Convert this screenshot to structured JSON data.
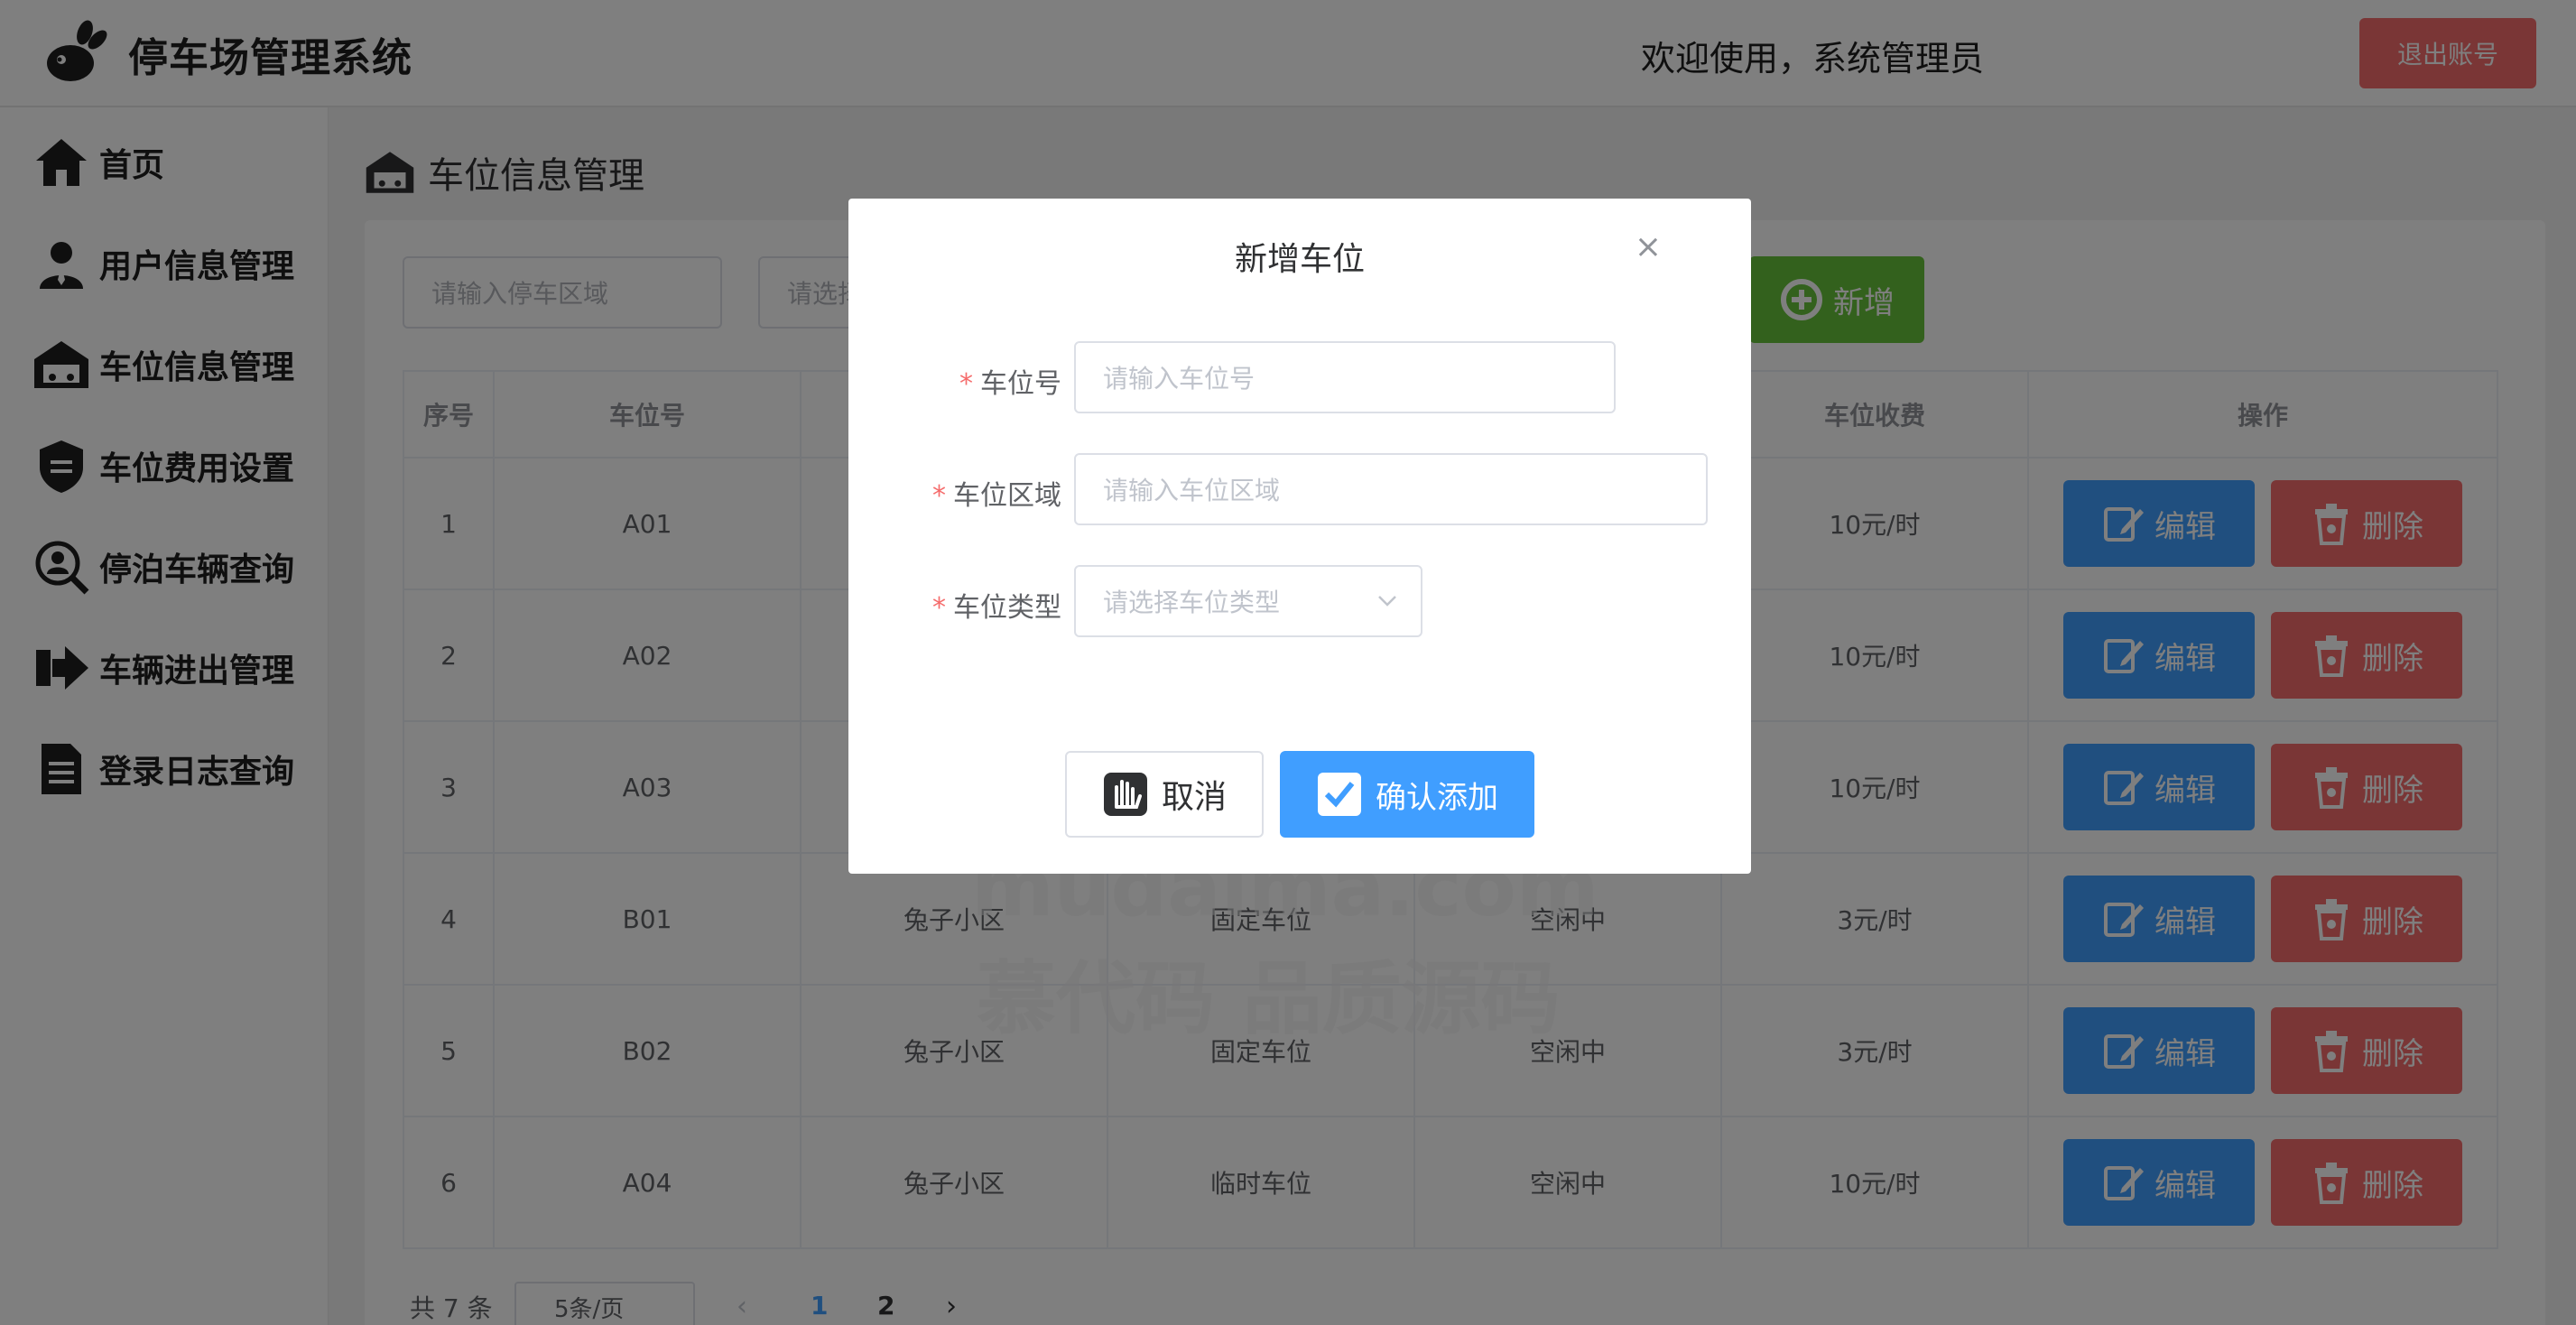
{
  "header": {
    "app_title": "停车场管理系统",
    "welcome": "欢迎使用，系统管理员",
    "logout_label": "退出账号"
  },
  "sidebar": {
    "items": [
      {
        "label": "首页",
        "icon": "home-icon"
      },
      {
        "label": "用户信息管理",
        "icon": "user-icon"
      },
      {
        "label": "车位信息管理",
        "icon": "garage-icon"
      },
      {
        "label": "车位费用设置",
        "icon": "badge-icon"
      },
      {
        "label": "停泊车辆查询",
        "icon": "search-user-icon"
      },
      {
        "label": "车辆进出管理",
        "icon": "arrow-right-icon"
      },
      {
        "label": "登录日志查询",
        "icon": "document-icon"
      }
    ]
  },
  "page": {
    "title": "车位信息管理",
    "search_area_placeholder": "请输入停车区域",
    "search_type_placeholder": "请选择",
    "add_label": "新增"
  },
  "table": {
    "headers": [
      "序号",
      "车位号",
      "",
      "",
      "",
      "车位收费",
      "操作"
    ],
    "rows": [
      [
        "1",
        "A01",
        "",
        "",
        "",
        "10元/时"
      ],
      [
        "2",
        "A02",
        "",
        "",
        "",
        "10元/时"
      ],
      [
        "3",
        "A03",
        "",
        "",
        "",
        "10元/时"
      ],
      [
        "4",
        "B01",
        "兔子小区",
        "固定车位",
        "空闲中",
        "3元/时"
      ],
      [
        "5",
        "B02",
        "兔子小区",
        "固定车位",
        "空闲中",
        "3元/时"
      ],
      [
        "6",
        "A04",
        "兔子小区",
        "临时车位",
        "空闲中",
        "10元/时"
      ]
    ],
    "edit_label": "编辑",
    "delete_label": "删除"
  },
  "pagination": {
    "total": "共 7 条",
    "page_size": "5条/页",
    "pages": [
      "1",
      "2"
    ],
    "current_page": "1"
  },
  "dialog": {
    "title": "新增车位",
    "close": "×",
    "fields": [
      {
        "label": "车位号",
        "placeholder": "请输入车位号"
      },
      {
        "label": "车位区域",
        "placeholder": "请输入车位区域"
      },
      {
        "label": "车位类型",
        "placeholder": "请选择车位类型"
      }
    ],
    "cancel_label": "取消",
    "confirm_label": "确认添加"
  },
  "watermark": {
    "line_cn": "慕代码 品质源码",
    "line_en": "mudaima.com"
  },
  "colors": {
    "primary": "#409eff",
    "success": "#67c23a",
    "danger": "#f56c6c"
  }
}
